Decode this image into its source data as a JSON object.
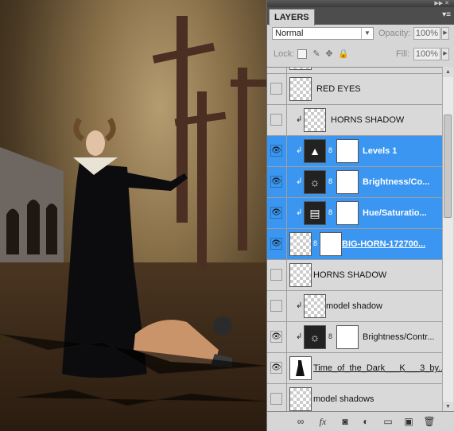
{
  "panel": {
    "tab_label": "LAYERS",
    "blend_mode": "Normal",
    "opacity_label": "Opacity:",
    "opacity_value": "100%",
    "lock_label": "Lock:",
    "fill_label": "Fill:",
    "fill_value": "100%"
  },
  "layers": [
    {
      "name": "RED EYES",
      "visible": false,
      "clipped": false,
      "selected": false,
      "thumb": "transparent",
      "mask": false
    },
    {
      "name": "HORNS SHADOW",
      "visible": false,
      "clipped": true,
      "selected": false,
      "thumb": "transparent",
      "mask": false
    },
    {
      "name": "Levels 1",
      "visible": true,
      "clipped": true,
      "selected": true,
      "thumb": "levels-adjustment",
      "mask": true
    },
    {
      "name": "Brightness/Co...",
      "visible": true,
      "clipped": true,
      "selected": true,
      "thumb": "brightness-adjustment",
      "mask": true
    },
    {
      "name": "Hue/Saturatio...",
      "visible": true,
      "clipped": true,
      "selected": true,
      "thumb": "hue-adjustment",
      "mask": true
    },
    {
      "name": "BIG-HORN-172700...",
      "visible": true,
      "clipped": false,
      "selected": true,
      "thumb": "transparent",
      "mask": true
    },
    {
      "name": "HORNS SHADOW",
      "visible": false,
      "clipped": false,
      "selected": false,
      "thumb": "transparent",
      "mask": false
    },
    {
      "name": "model shadow",
      "visible": false,
      "clipped": true,
      "selected": false,
      "thumb": "transparent",
      "mask": false
    },
    {
      "name": "Brightness/Contr...",
      "visible": true,
      "clipped": true,
      "selected": false,
      "thumb": "brightness-adjustment",
      "mask": true
    },
    {
      "name": "Time_of_the_Dark___K___3_by...",
      "visible": true,
      "clipped": false,
      "selected": false,
      "thumb": "figure",
      "mask": false
    },
    {
      "name": "model shadows",
      "visible": false,
      "clipped": false,
      "selected": false,
      "thumb": "transparent",
      "mask": false
    }
  ],
  "bottom_icons": [
    "link-layers-icon",
    "fx-icon",
    "add-mask-icon",
    "adjustment-layer-icon",
    "new-group-icon",
    "new-layer-icon",
    "trash-icon"
  ],
  "colors": {
    "selection": "#3a96f0",
    "panel_bg": "#d6d6d6"
  }
}
